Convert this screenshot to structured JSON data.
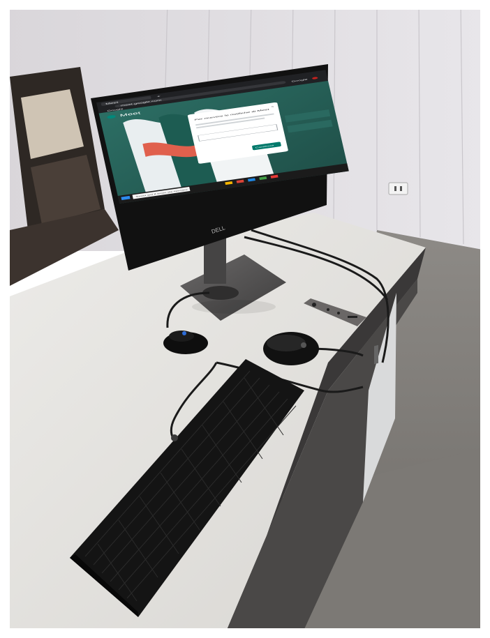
{
  "scene": {
    "brand": "DELL"
  },
  "browser": {
    "tab_title": "Meet",
    "new_tab_glyph": "+",
    "url": "meet.google.com",
    "bookmark_label": "Google",
    "profile_label": "Google"
  },
  "meet": {
    "logo_label": "Meet",
    "dialog": {
      "title": "Per ricevere le notifiche di Meet",
      "button_label": "Continua"
    }
  },
  "taskbar": {
    "search_placeholder": "Scrivi qui il testo da cercare"
  },
  "keyboard": {
    "brand_logo": "hp-logo"
  },
  "mouse": {
    "brand_logo": "hp-logo"
  }
}
